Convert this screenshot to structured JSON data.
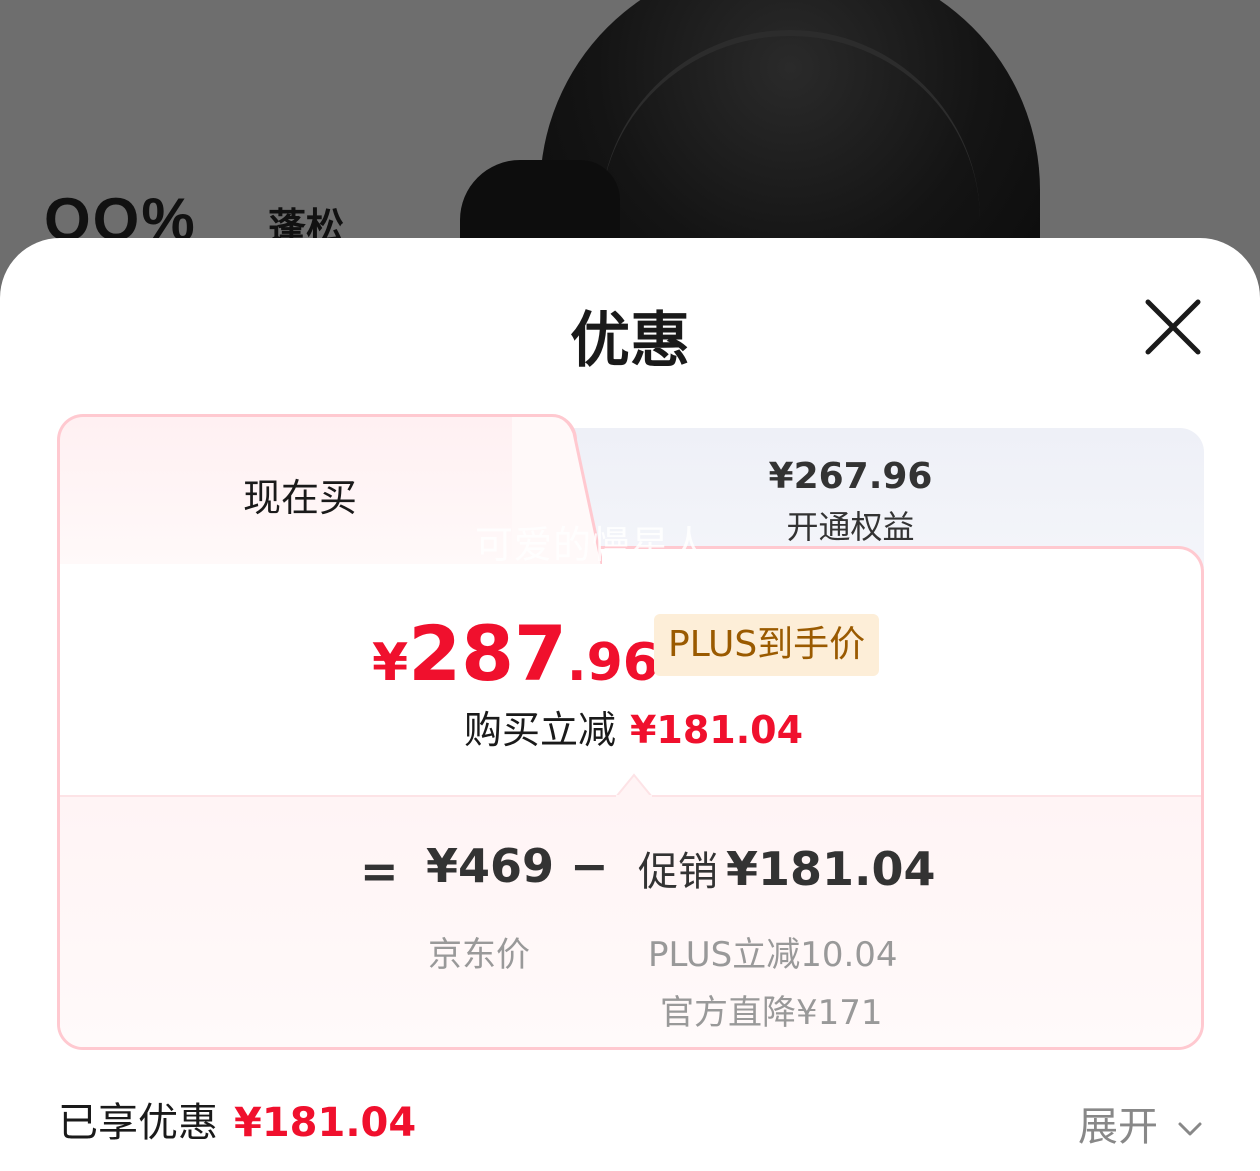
{
  "banner": {
    "brand_logo": "OO%",
    "brand_name": "蓬松"
  },
  "sheet": {
    "title": "优惠",
    "close_icon": "close-icon"
  },
  "tabs": {
    "current": {
      "label": "现在买"
    },
    "plus": {
      "price": "¥267.96",
      "label": "开通权益"
    }
  },
  "watermark": "可爱的慢星人",
  "price": {
    "yen": "¥",
    "integer": "287",
    "decimal": ".96",
    "badge": "PLUS到手价",
    "save_label": "购买立减",
    "save_amount": "¥181.04"
  },
  "calc": {
    "equals": "=",
    "base_price": "¥469",
    "base_label": "京东价",
    "minus": "−",
    "promo_label": "促销",
    "promo_amount": "¥181.04",
    "details": [
      "PLUS立减10.04",
      "官方直降¥171"
    ]
  },
  "footer": {
    "enjoyed_label": "已享优惠",
    "enjoyed_amount": "¥181.04",
    "expand_label": "展开",
    "expand_icon": "chevron-down-icon"
  },
  "colors": {
    "accent_red": "#f0102d",
    "badge_bg": "#fdeed8",
    "badge_text": "#9a5a00",
    "card_border": "#ffc9d0"
  }
}
